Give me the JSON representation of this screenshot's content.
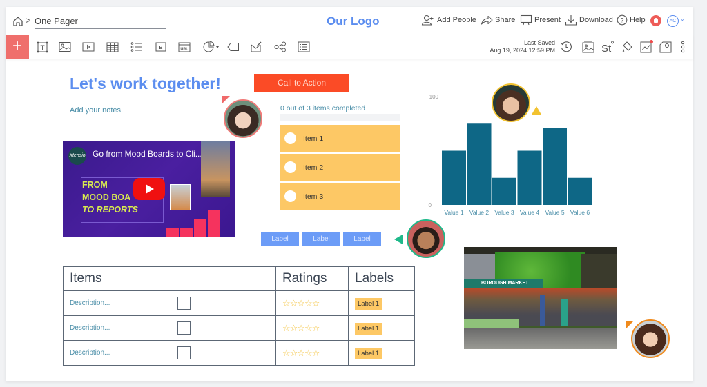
{
  "header": {
    "breadcrumb_home": "home-icon",
    "breadcrumb_separator": ">",
    "doc_title": "One Pager",
    "logo": "Our Logo",
    "actions": [
      {
        "label": "Add People",
        "icon": "add-person-icon"
      },
      {
        "label": "Share",
        "icon": "share-icon"
      },
      {
        "label": "Present",
        "icon": "present-icon"
      },
      {
        "label": "Download",
        "icon": "download-icon"
      },
      {
        "label": "Help",
        "icon": "help-icon"
      }
    ],
    "user_initials": "AC"
  },
  "toolbar": {
    "add_label": "+",
    "tools": [
      "text-icon",
      "image-icon",
      "video-icon",
      "table-icon",
      "list-icon",
      "button-icon",
      "url-icon",
      "chart-icon",
      "label-icon",
      "checklist-icon",
      "share-nodes-icon",
      "form-icon"
    ],
    "last_saved_label": "Last Saved",
    "last_saved_time": "Aug 19, 2024 12:59 PM",
    "right_tools": [
      "history-icon",
      "background-image-icon",
      "style-icon",
      "fill-icon",
      "analytics-icon",
      "settings-icon",
      "more-icon"
    ]
  },
  "content": {
    "title": "Let's work together!",
    "notes": "Add your notes.",
    "cta_label": "Call to Action",
    "video": {
      "title": "Go from Mood Boards to Cli...",
      "channel": "Xtensio",
      "lines": [
        "FROM",
        "MOOD BOA",
        "TO REPORTS"
      ]
    },
    "checklist": {
      "status": "0 out of 3 items completed",
      "progress": 0,
      "items": [
        "Item 1",
        "Item 2",
        "Item 3"
      ]
    },
    "labels": [
      "Label",
      "Label",
      "Label"
    ],
    "table": {
      "headers": [
        "Items",
        "",
        "Ratings",
        "Labels"
      ],
      "rows": [
        {
          "description": "Description...",
          "rating": 0,
          "label": "Label 1"
        },
        {
          "description": "Description...",
          "rating": 0,
          "label": "Label 1"
        },
        {
          "description": "Description...",
          "rating": 0,
          "label": "Label 1"
        }
      ],
      "stars_glyph": "☆☆☆☆☆"
    },
    "image_caption": "BOROUGH MARKET"
  },
  "colors": {
    "accent_blue": "#5b8def",
    "cta": "#fb4b26",
    "checklist": "#fdc865",
    "bar": "#0e6786",
    "add_button": "#ef6f6c"
  },
  "chart_data": {
    "type": "bar",
    "categories": [
      "Value 1",
      "Value 2",
      "Value 3",
      "Value 4",
      "Value 5",
      "Value 6"
    ],
    "values": [
      50,
      75,
      25,
      50,
      71,
      25
    ],
    "title": "",
    "xlabel": "",
    "ylabel": "",
    "ylim": [
      0,
      100
    ],
    "yticks": [
      "0",
      "100"
    ],
    "grid": false
  }
}
